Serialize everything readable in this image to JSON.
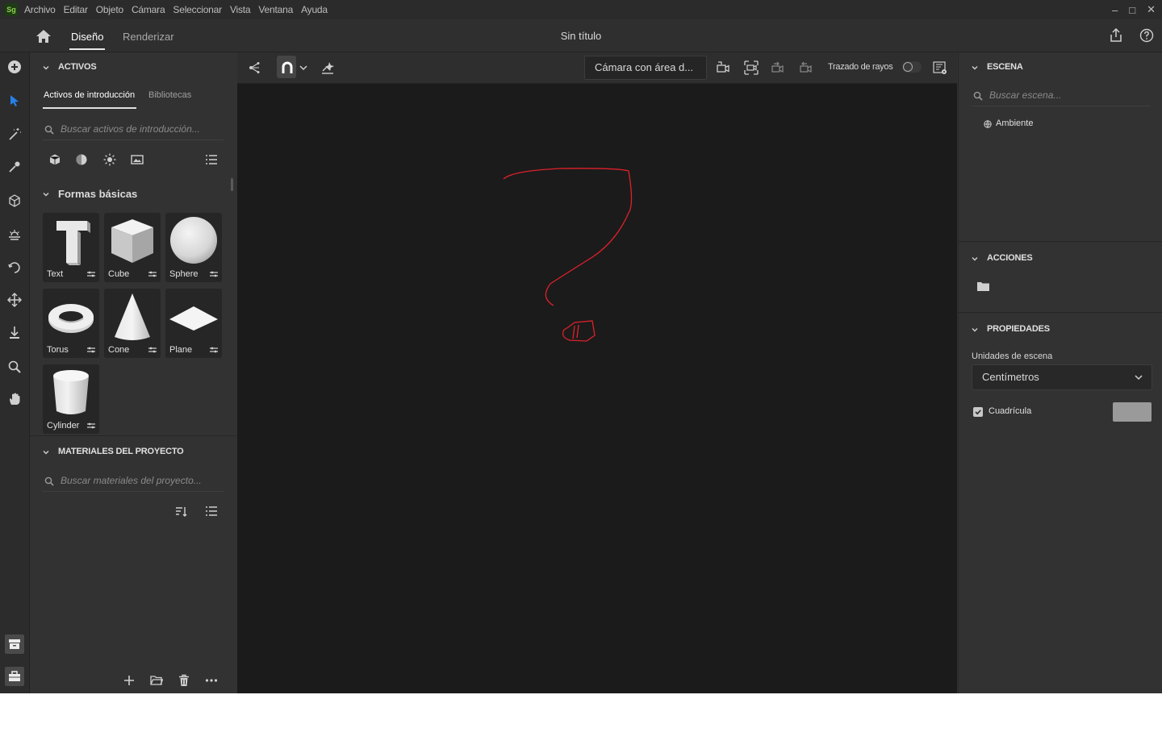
{
  "menubar": {
    "logo": "Sg",
    "items": [
      "Archivo",
      "Editar",
      "Objeto",
      "Cámara",
      "Seleccionar",
      "Vista",
      "Ventana",
      "Ayuda"
    ],
    "window_controls": [
      "–",
      "□",
      "✕"
    ]
  },
  "titlebar": {
    "tabs": {
      "design": "Diseño",
      "render": "Renderizar"
    },
    "doc_title": "Sin título"
  },
  "assets": {
    "title": "ACTIVOS",
    "tabs": [
      "Activos de introducción",
      "Bibliotecas"
    ],
    "search_placeholder": "Buscar activos de introducción...",
    "filter_icons": [
      "models-icon",
      "materials-icon",
      "lights-icon",
      "images-icon"
    ],
    "basic_shapes_title": "Formas básicas",
    "shapes": [
      "Text",
      "Cube",
      "Sphere",
      "Torus",
      "Cone",
      "Plane",
      "Cylinder"
    ]
  },
  "project_materials": {
    "title": "MATERIALES DEL PROYECTO",
    "search_placeholder": "Buscar materiales del proyecto..."
  },
  "viewport_toolbar": {
    "camera_select": "Cámara con área d...",
    "raytrace_label": "Trazado de rayos"
  },
  "scene": {
    "title": "ESCENA",
    "search_placeholder": "Buscar escena...",
    "items": [
      "Ambiente"
    ]
  },
  "actions": {
    "title": "ACCIONES"
  },
  "properties": {
    "title": "PROPIEDADES",
    "units_label": "Unidades de escena",
    "units_value": "Centímetros",
    "grid_label": "Cuadrícula",
    "grid_color": "#9a9a9a"
  },
  "colors": {
    "accent": "#2680eb",
    "annotation": "#e0202a"
  }
}
